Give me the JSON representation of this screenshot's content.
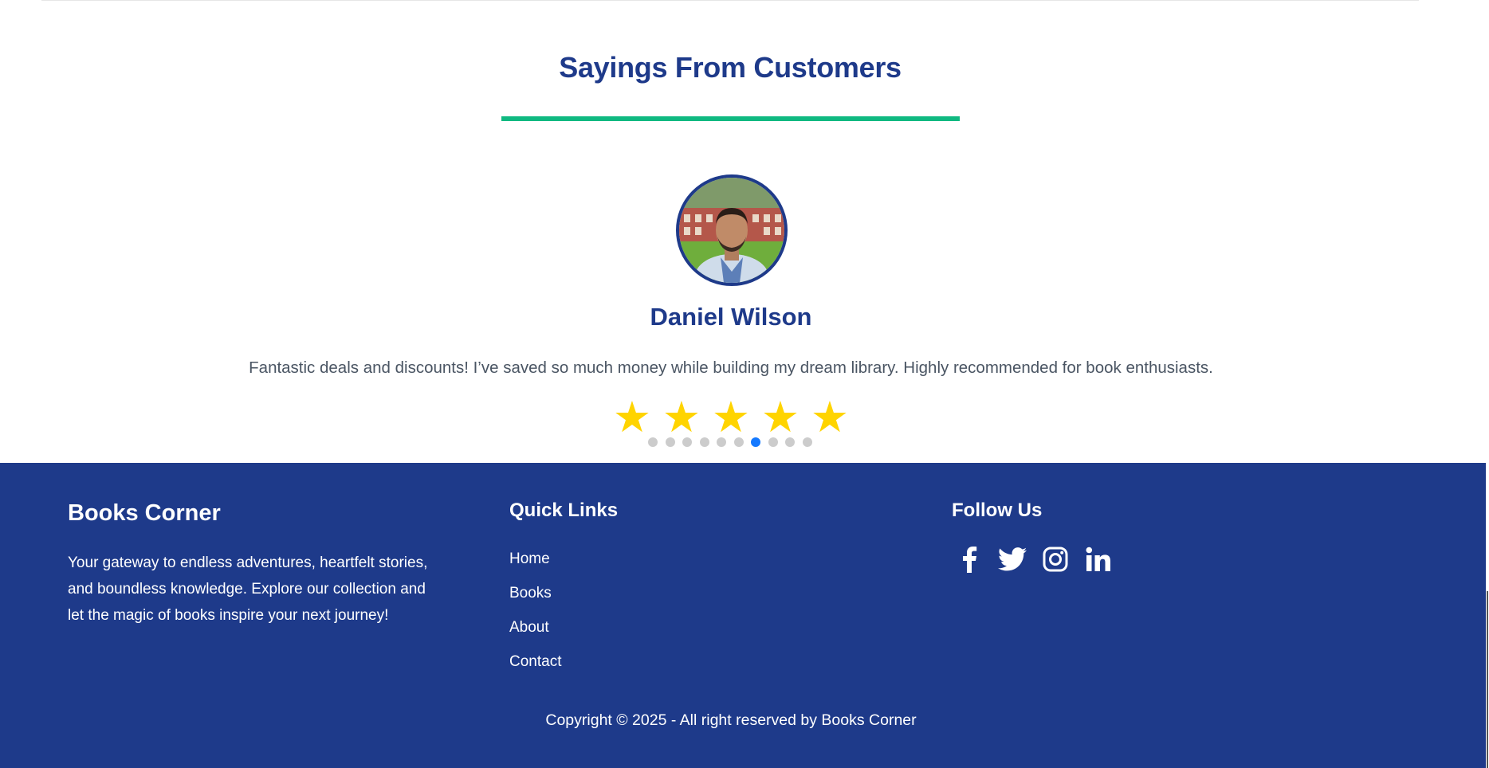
{
  "testimonials": {
    "section_title": "Sayings From Customers",
    "customer_name": "Daniel Wilson",
    "quote": "Fantastic deals and discounts! I’ve saved so much money while building my dream library. Highly recommended for book enthusiasts.",
    "rating": 5,
    "stars": [
      "★",
      "★",
      "★",
      "★",
      "★"
    ],
    "carousel": {
      "total": 10,
      "active_index": 6
    }
  },
  "footer": {
    "brand": "Books Corner",
    "about": "Your gateway to endless adventures, heartfelt stories, and boundless knowledge. Explore our collection and let the magic of books inspire your next journey!",
    "quick_links_title": "Quick Links",
    "quick_links": [
      "Home",
      "Books",
      "About",
      "Contact"
    ],
    "follow_title": "Follow Us",
    "social_icons": [
      "facebook-icon",
      "twitter-icon",
      "instagram-icon",
      "linkedin-icon"
    ],
    "copyright": "Copyright © 2025 - All right reserved by Books Corner"
  },
  "colors": {
    "brand_blue": "#1e3a8a",
    "accent_green": "#10b981",
    "star_yellow": "#ffd400",
    "dot_active": "#1479ff",
    "dot_inactive": "#cccccc"
  }
}
